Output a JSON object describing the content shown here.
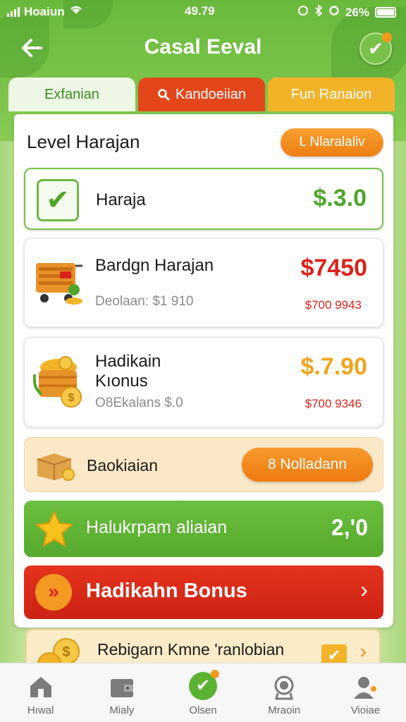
{
  "status_bar": {
    "carrier": "Hoaiun",
    "time": "49.79",
    "battery": "26%"
  },
  "header": {
    "title": "Casal Eeval"
  },
  "tabs": [
    {
      "label": "Exfanian"
    },
    {
      "label": "Kandoeiian"
    },
    {
      "label": "Fun Ranaion"
    }
  ],
  "panel": {
    "title": "Level Harajan",
    "pill_label": "L Nlaralaliv"
  },
  "rows": [
    {
      "name": "Haraja",
      "price": "$.3.0"
    },
    {
      "name": "Bardgn Harajan",
      "sub": "Deolaan: $1 910",
      "price": "$7450",
      "sub_price": "$700 9943"
    },
    {
      "name": "Hadikain Kıonus",
      "sub": "O8Ekalans $.0",
      "price": "$.7.90",
      "sub_price": "$700 9346"
    }
  ],
  "box_row": {
    "label": "Baokiaian",
    "button": "8 Nolladann"
  },
  "green_row": {
    "label": "Halukrpam aliaian",
    "value": "2,'0"
  },
  "red_row": {
    "label": "Hadikahn Bonus"
  },
  "peek_row": {
    "label": "Rebigarn Kmne 'ranlobian"
  },
  "bottom_nav": [
    {
      "label": "Hıwal"
    },
    {
      "label": "Mialy"
    },
    {
      "label": "Olsen"
    },
    {
      "label": "Mraoin"
    },
    {
      "label": "Vioiae"
    }
  ],
  "colors": {
    "brand_green": "#6ab93d",
    "accent_orange": "#ee7e12",
    "alert_red": "#d9241b",
    "gold": "#f0a41c"
  }
}
